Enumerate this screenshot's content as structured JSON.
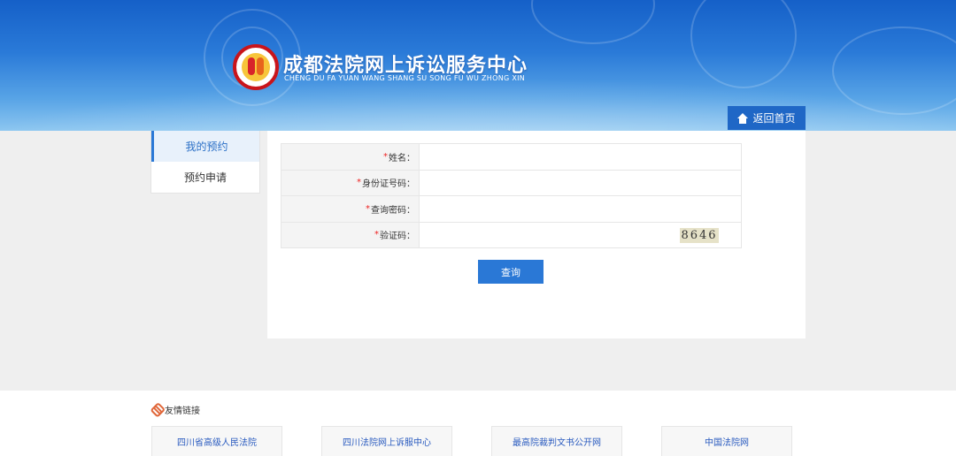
{
  "header": {
    "title": "成都法院网上诉讼服务中心",
    "subtitle": "CHENG DU FA YUAN WANG SHANG SU SONG FU WU ZHONG XIN",
    "home_label": "返回首页",
    "logo_icon": "court-emblem-icon",
    "home_icon": "home-icon"
  },
  "sidebar": {
    "items": [
      {
        "label": "我的预约",
        "active": true
      },
      {
        "label": "预约申请",
        "active": false
      }
    ]
  },
  "form": {
    "fields": [
      {
        "required": "*",
        "label": "姓名：",
        "value": ""
      },
      {
        "required": "*",
        "label": "身份证号码：",
        "value": ""
      },
      {
        "required": "*",
        "label": "查询密码：",
        "value": ""
      },
      {
        "required": "*",
        "label": "验证码：",
        "value": ""
      }
    ],
    "captcha_text": "8646",
    "submit_label": "查询"
  },
  "footer": {
    "title": "友情链接",
    "title_icon": "link-icon",
    "links": [
      "四川省高级人民法院",
      "四川法院网上诉服中心",
      "最高院裁判文书公开网",
      "中国法院网"
    ]
  },
  "colors": {
    "accent": "#2a78d6",
    "header_top": "#1560c8",
    "required": "#e22222",
    "link": "#2a5bbf"
  }
}
